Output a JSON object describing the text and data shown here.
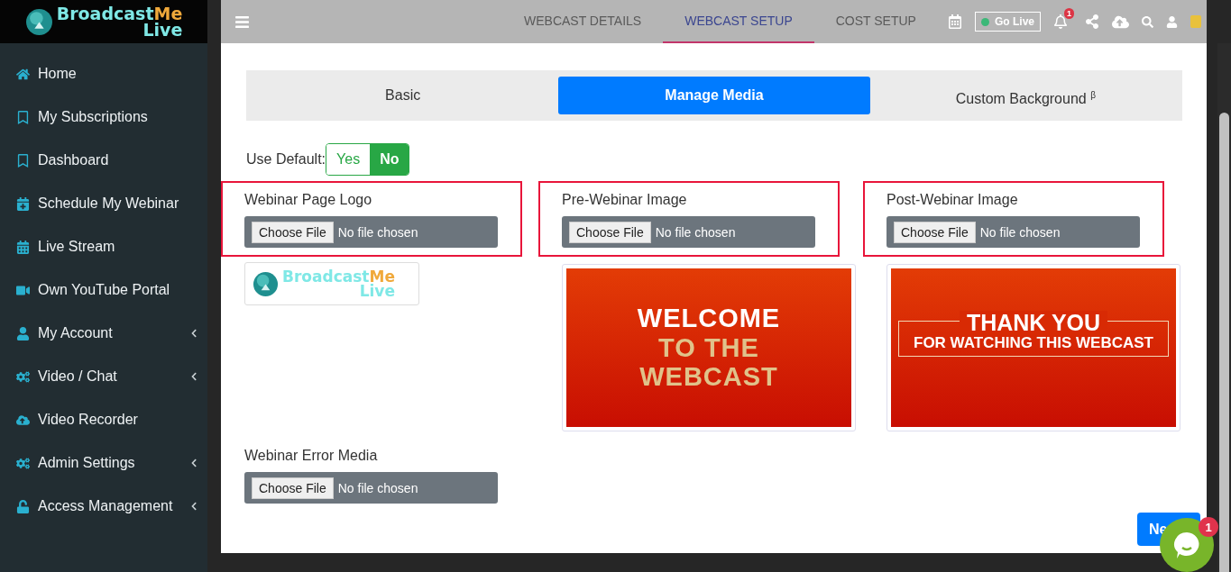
{
  "brand": {
    "main": "Broadcast",
    "accent": "Me",
    "sub": "Live"
  },
  "sidebar": {
    "items": [
      {
        "label": "Home",
        "expandable": false
      },
      {
        "label": "My Subscriptions",
        "expandable": false
      },
      {
        "label": "Dashboard",
        "expandable": false
      },
      {
        "label": "Schedule My Webinar",
        "expandable": false
      },
      {
        "label": "Live Stream",
        "expandable": false
      },
      {
        "label": "Own YouTube Portal",
        "expandable": false
      },
      {
        "label": "My Account",
        "expandable": true
      },
      {
        "label": "Video / Chat",
        "expandable": true
      },
      {
        "label": "Video Recorder",
        "expandable": false
      },
      {
        "label": "Admin Settings",
        "expandable": true
      },
      {
        "label": "Access Management",
        "expandable": true
      }
    ]
  },
  "header": {
    "tabs": [
      {
        "label": "WEBCAST DETAILS",
        "selected": false
      },
      {
        "label": "WEBCAST SETUP",
        "selected": true
      },
      {
        "label": "COST SETUP",
        "selected": false
      }
    ],
    "go_live": "Go Live",
    "notification_count": "1"
  },
  "media_tabs": [
    {
      "label": "Basic",
      "selected": false
    },
    {
      "label": "Manage Media",
      "selected": true
    },
    {
      "label": "Custom Background $^{β}$",
      "selected": false
    }
  ],
  "use_default": {
    "label": "Use Default:",
    "options": [
      {
        "label": "Yes",
        "selected": false
      },
      {
        "label": "No",
        "selected": true
      }
    ]
  },
  "media": [
    {
      "label": "Webinar Page Logo",
      "button": "Choose File",
      "status": "No file chosen",
      "highlighted": true,
      "preview": {
        "kind": "logo",
        "main": "Broadcast",
        "accent": "Me",
        "sub": "Live"
      }
    },
    {
      "label": "Pre-Webinar Image",
      "button": "Choose File",
      "status": "No file chosen",
      "highlighted": true,
      "preview": {
        "kind": "welcome",
        "lines": [
          "WELCOME",
          "TO THE",
          "WEBCAST"
        ]
      }
    },
    {
      "label": "Post-Webinar Image",
      "button": "Choose File",
      "status": "No file chosen",
      "highlighted": true,
      "preview": {
        "kind": "thanks",
        "lines": [
          "THANK YOU",
          "FOR WATCHING THIS WEBCAST"
        ]
      }
    },
    {
      "label": "Webinar Error Media",
      "button": "Choose File",
      "status": "No file chosen",
      "highlighted": false
    }
  ],
  "next_button": "Ne",
  "chat": {
    "badge": "1"
  }
}
